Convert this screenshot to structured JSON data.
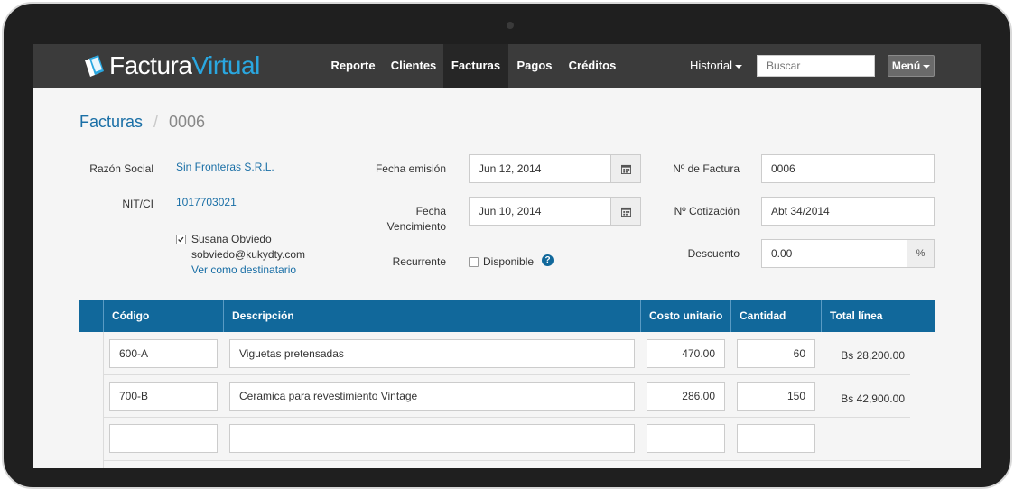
{
  "app": {
    "logo_primary": "Factura",
    "logo_accent": "Virtual"
  },
  "nav": {
    "items": [
      {
        "label": "Reporte"
      },
      {
        "label": "Clientes"
      },
      {
        "label": "Facturas",
        "active": true
      },
      {
        "label": "Pagos"
      },
      {
        "label": "Créditos"
      }
    ],
    "historial": "Historial",
    "search_placeholder": "Buscar",
    "menu_label": "Menú"
  },
  "breadcrumb": {
    "root": "Facturas",
    "separator": "/",
    "current": "0006"
  },
  "client": {
    "razon_social_label": "Razón Social",
    "razon_social_value": "Sin Fronteras S.R.L.",
    "nit_label": "NIT/CI",
    "nit_value": "1017703021",
    "contact_name": "Susana Obviedo",
    "contact_email": "sobviedo@kukydty.com",
    "contact_link": "Ver como destinatario",
    "contact_checked": true
  },
  "dates": {
    "emision_label": "Fecha emisión",
    "emision_value": "Jun 12, 2014",
    "vencimiento_label_1": "Fecha",
    "vencimiento_label_2": "Vencimiento",
    "vencimiento_value": "Jun 10, 2014",
    "recurrente_label": "Recurrente",
    "disponible_label": "Disponible",
    "help_icon": "?"
  },
  "invoice": {
    "numero_label": "Nº de Factura",
    "numero_value": "0006",
    "cotizacion_label": "Nº Cotización",
    "cotizacion_value": "Abt 34/2014",
    "descuento_label": "Descuento",
    "descuento_value": "0.00",
    "descuento_unit": "%"
  },
  "table": {
    "headers": [
      "Código",
      "Descripción",
      "Costo unitario",
      "Cantidad",
      "Total línea"
    ],
    "rows": [
      {
        "codigo": "600-A",
        "descripcion": "Viguetas pretensadas",
        "costo": "470.00",
        "cantidad": "60",
        "total": "Bs 28,200.00"
      },
      {
        "codigo": "700-B",
        "descripcion": "Ceramica para revestimiento Vintage",
        "costo": "286.00",
        "cantidad": "150",
        "total": "Bs 42,900.00"
      },
      {
        "codigo": "",
        "descripcion": "",
        "costo": "",
        "cantidad": "",
        "total": ""
      }
    ]
  },
  "colors": {
    "navbar": "#3b3b3b",
    "accent": "#2aa7e0",
    "link": "#1a6fa6",
    "table_header": "#11689b"
  }
}
